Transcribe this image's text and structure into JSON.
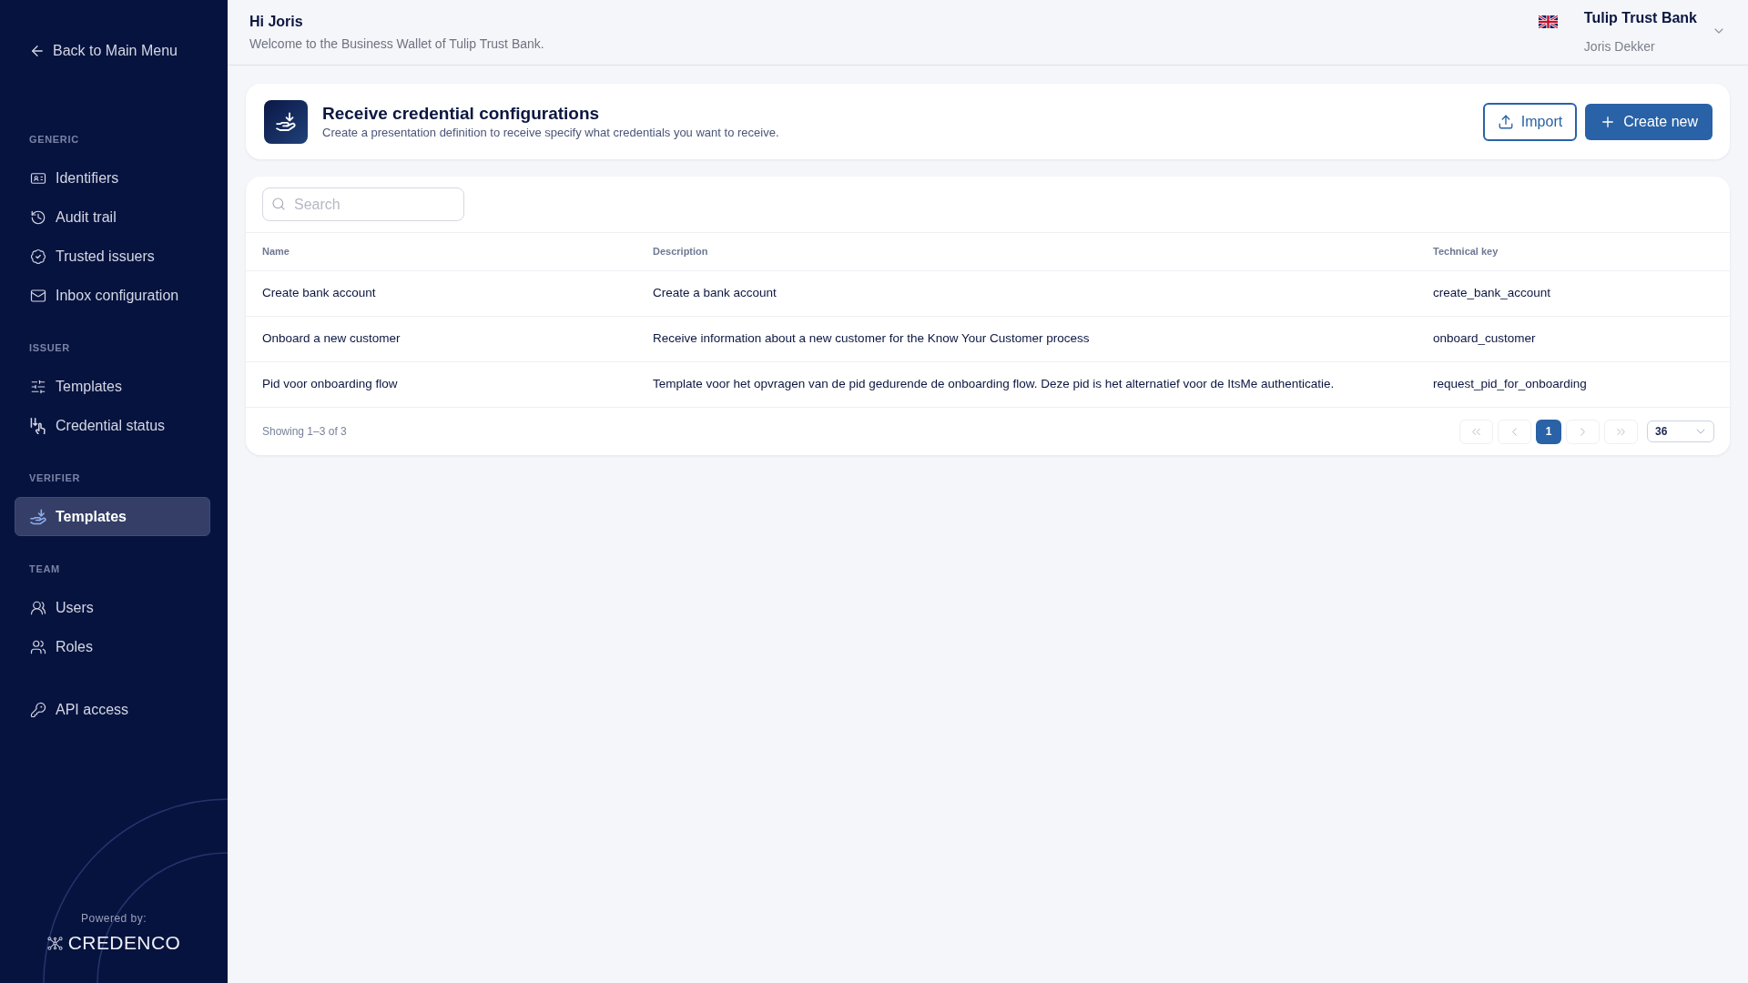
{
  "sidebar": {
    "back_link": "Back to Main Menu",
    "sections": [
      {
        "title": "GENERIC",
        "items": [
          {
            "label": "Identifiers",
            "selected": false
          },
          {
            "label": "Audit trail",
            "selected": false
          },
          {
            "label": "Trusted issuers",
            "selected": false
          },
          {
            "label": "Inbox configuration",
            "selected": false
          }
        ]
      },
      {
        "title": "ISSUER",
        "items": [
          {
            "label": "Templates",
            "selected": false
          },
          {
            "label": "Credential status",
            "selected": false
          }
        ]
      },
      {
        "title": "VERIFIER",
        "items": [
          {
            "label": "Templates",
            "selected": true
          }
        ]
      },
      {
        "title": "TEAM",
        "items": [
          {
            "label": "Users",
            "selected": false
          },
          {
            "label": "Roles",
            "selected": false
          }
        ]
      },
      {
        "items": [
          {
            "label": "API access",
            "selected": false
          }
        ]
      }
    ],
    "footer": {
      "powered_by": "Powered by:",
      "brand": "CREDENCO"
    }
  },
  "header": {
    "greeting": "Hi Joris",
    "welcome": "Welcome to the Business Wallet of Tulip Trust Bank.",
    "organization": "Tulip Trust Bank",
    "user": "Joris Dekker"
  },
  "page": {
    "title": "Receive credential configurations",
    "subtitle": "Create a presentation definition to receive specify what credentials you want to receive.",
    "buttons": [
      {
        "kind": "outline",
        "label": "Import"
      },
      {
        "kind": "primary",
        "label": "Create new"
      }
    ]
  },
  "table": {
    "search": {
      "placeholder": "Search"
    },
    "columns": [
      "Name",
      "Description",
      "Technical key"
    ],
    "rows": [
      [
        "Create bank account",
        "Create a bank account",
        "create_bank_account"
      ],
      [
        "Onboard a new customer",
        "Receive information about a new customer for the Know Your Customer process",
        "onboard_customer"
      ],
      [
        "Pid voor onboarding flow",
        "Template voor het opvragen van de pid gedurende de onboarding flow. Deze pid is het alternatief voor de ItsMe authenticatie.",
        "request_pid_for_onboarding"
      ]
    ],
    "footer": {
      "summary": "Showing 1–3 of 3",
      "controls": [
        {
          "kind": "first",
          "disabled": true
        },
        {
          "kind": "previous",
          "disabled": true
        },
        {
          "kind": "page",
          "label": "1",
          "selected": true
        },
        {
          "kind": "next",
          "disabled": true
        },
        {
          "kind": "last",
          "disabled": true
        }
      ],
      "page_size": "36"
    }
  }
}
